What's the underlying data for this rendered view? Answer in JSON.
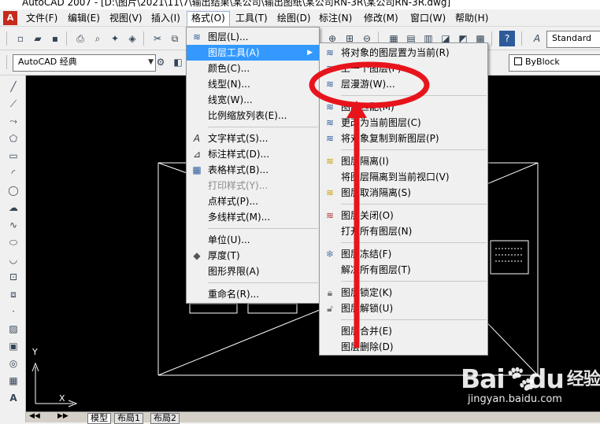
{
  "window": {
    "title": "AutoCAD 2007 - [D:\\图片\\2021\\11\\7\\输出结果\\某公司\\输出图纸\\某公司RN-3R\\某公司RN-3R.dwg]"
  },
  "menubar": {
    "items": [
      {
        "label": "文件(F)"
      },
      {
        "label": "编辑(E)"
      },
      {
        "label": "视图(V)"
      },
      {
        "label": "插入(I)"
      },
      {
        "label": "格式(O)"
      },
      {
        "label": "工具(T)"
      },
      {
        "label": "绘图(D)"
      },
      {
        "label": "标注(N)"
      },
      {
        "label": "修改(M)"
      },
      {
        "label": "窗口(W)"
      },
      {
        "label": "帮助(H)"
      }
    ],
    "active_index": 4
  },
  "toolbar": {
    "workspace": "AutoCAD 经典",
    "text_style": "Standard",
    "linetype": "ByBlock"
  },
  "format_menu": {
    "items": [
      {
        "label": "图层(L)...",
        "icon": "layers-icon"
      },
      {
        "label": "图层工具(A)",
        "icon": "",
        "submenu": true
      },
      {
        "label": "颜色(C)...",
        "icon": ""
      },
      {
        "label": "线型(N)...",
        "icon": ""
      },
      {
        "label": "线宽(W)...",
        "icon": ""
      },
      {
        "label": "比例缩放列表(E)...",
        "icon": ""
      },
      {
        "label": "文字样式(S)...",
        "icon": "text-style-icon"
      },
      {
        "label": "标注样式(D)...",
        "icon": "dim-style-icon"
      },
      {
        "label": "表格样式(B)...",
        "icon": "table-style-icon"
      },
      {
        "label": "打印样式(Y)...",
        "icon": "",
        "disabled": true
      },
      {
        "label": "点样式(P)...",
        "icon": ""
      },
      {
        "label": "多线样式(M)...",
        "icon": ""
      },
      {
        "label": "单位(U)...",
        "icon": ""
      },
      {
        "label": "厚度(T)",
        "icon": "thickness-icon"
      },
      {
        "label": "图形界限(A)",
        "icon": ""
      },
      {
        "label": "重命名(R)...",
        "icon": ""
      }
    ]
  },
  "layer_tools_menu": {
    "items": [
      {
        "label": "将对象的图层置为当前(R)"
      },
      {
        "label": "上一个图层(P)"
      },
      {
        "label": "层漫游(W)..."
      },
      {
        "label": "图层匹配(M)"
      },
      {
        "label": "更改为当前图层(C)"
      },
      {
        "label": "将对象复制到新图层(P)"
      },
      {
        "label": "图层隔离(I)"
      },
      {
        "label": "将图层隔离到当前视口(V)"
      },
      {
        "label": "图层取消隔离(S)"
      },
      {
        "label": "图层关闭(O)"
      },
      {
        "label": "打开所有图层(N)"
      },
      {
        "label": "图层冻结(F)"
      },
      {
        "label": "解冻所有图层(T)"
      },
      {
        "label": "图层锁定(K)"
      },
      {
        "label": "图层解锁(U)"
      },
      {
        "label": "图层合并(E)"
      },
      {
        "label": "图层删除(D)"
      }
    ]
  },
  "layout_tabs": [
    {
      "label": "模型"
    },
    {
      "label": "布局1"
    },
    {
      "label": "布局2"
    }
  ],
  "watermark": {
    "brand": "Bai",
    "brand_tail": "du",
    "suffix": "经验",
    "url": "jingyan.baidu.com"
  },
  "annotation": {
    "color": "#e8141c"
  },
  "ucs": {
    "x_label": "X",
    "y_label": "Y"
  }
}
